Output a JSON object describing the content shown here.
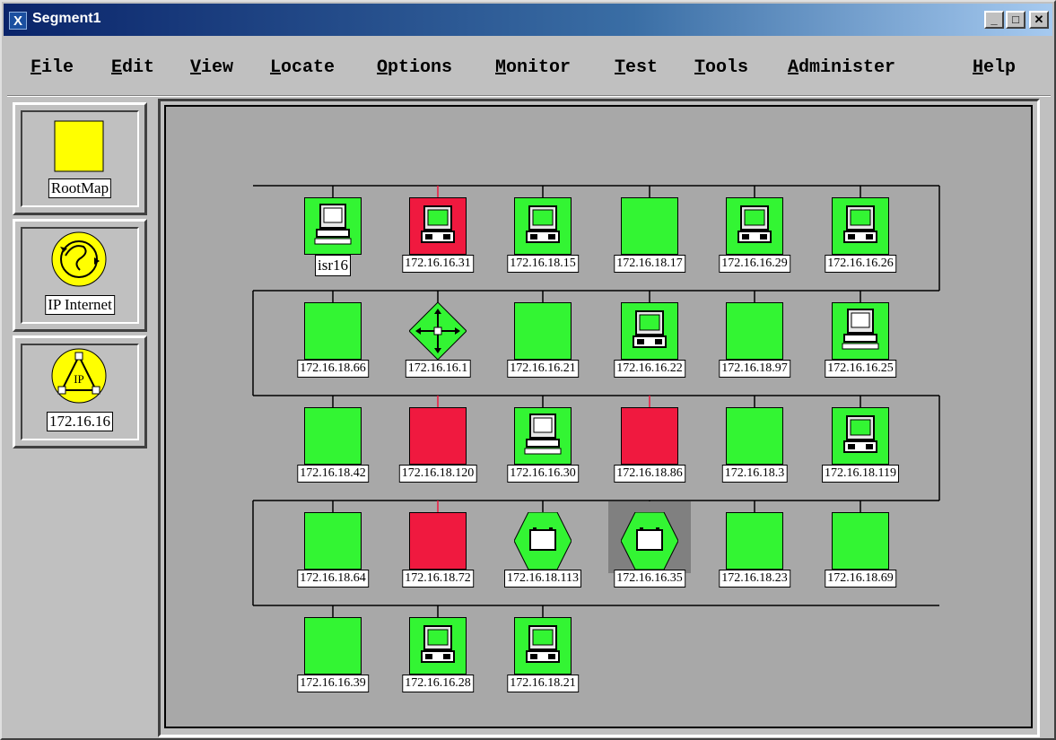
{
  "window": {
    "title": "Segment1",
    "title_icon": "X",
    "min": "_",
    "max": "□",
    "close": "✕"
  },
  "menu": [
    "File",
    "Edit",
    "View",
    "Locate",
    "Options",
    "Monitor",
    "Test",
    "Tools",
    "Administer",
    "Help"
  ],
  "sidebar": [
    {
      "label": "RootMap",
      "icon": "root-map-icon"
    },
    {
      "label": "IP Internet",
      "icon": "globe-icon"
    },
    {
      "label": "172.16.16",
      "icon": "ip-network-icon",
      "icon_text": "IP"
    }
  ],
  "colors": {
    "up": "#33f533",
    "down": "#f0193f",
    "warn": "#ffff00"
  },
  "nodes": [
    {
      "label": "isr16",
      "status": "up",
      "icon": "workstation"
    },
    {
      "label": "172.16.16.31",
      "status": "down",
      "icon": "pc"
    },
    {
      "label": "172.16.18.15",
      "status": "up",
      "icon": "pc"
    },
    {
      "label": "172.16.18.17",
      "status": "up",
      "icon": "none"
    },
    {
      "label": "172.16.16.29",
      "status": "up",
      "icon": "pc"
    },
    {
      "label": "172.16.16.26",
      "status": "up",
      "icon": "pc"
    },
    {
      "label": "172.16.18.66",
      "status": "up",
      "icon": "none"
    },
    {
      "label": "172.16.16.1",
      "status": "up",
      "icon": "router"
    },
    {
      "label": "172.16.16.21",
      "status": "up",
      "icon": "none"
    },
    {
      "label": "172.16.16.22",
      "status": "up",
      "icon": "pc"
    },
    {
      "label": "172.16.18.97",
      "status": "up",
      "icon": "none"
    },
    {
      "label": "172.16.16.25",
      "status": "up",
      "icon": "workstation"
    },
    {
      "label": "172.16.18.42",
      "status": "up",
      "icon": "none"
    },
    {
      "label": "172.16.18.120",
      "status": "down",
      "icon": "none"
    },
    {
      "label": "172.16.16.30",
      "status": "up",
      "icon": "workstation"
    },
    {
      "label": "172.16.18.86",
      "status": "down",
      "icon": "none"
    },
    {
      "label": "172.16.18.3",
      "status": "up",
      "icon": "none"
    },
    {
      "label": "172.16.18.119",
      "status": "up",
      "icon": "pc"
    },
    {
      "label": "172.16.18.64",
      "status": "up",
      "icon": "none"
    },
    {
      "label": "172.16.18.72",
      "status": "down",
      "icon": "none"
    },
    {
      "label": "172.16.18.113",
      "status": "up",
      "icon": "hex-box"
    },
    {
      "label": "172.16.16.35",
      "status": "up",
      "icon": "hex-box",
      "selected": true
    },
    {
      "label": "172.16.18.23",
      "status": "up",
      "icon": "none"
    },
    {
      "label": "172.16.18.69",
      "status": "up",
      "icon": "none"
    },
    {
      "label": "172.16.16.39",
      "status": "up",
      "icon": "none"
    },
    {
      "label": "172.16.16.28",
      "status": "up",
      "icon": "pc"
    },
    {
      "label": "172.16.18.21",
      "status": "up",
      "icon": "pc"
    }
  ]
}
